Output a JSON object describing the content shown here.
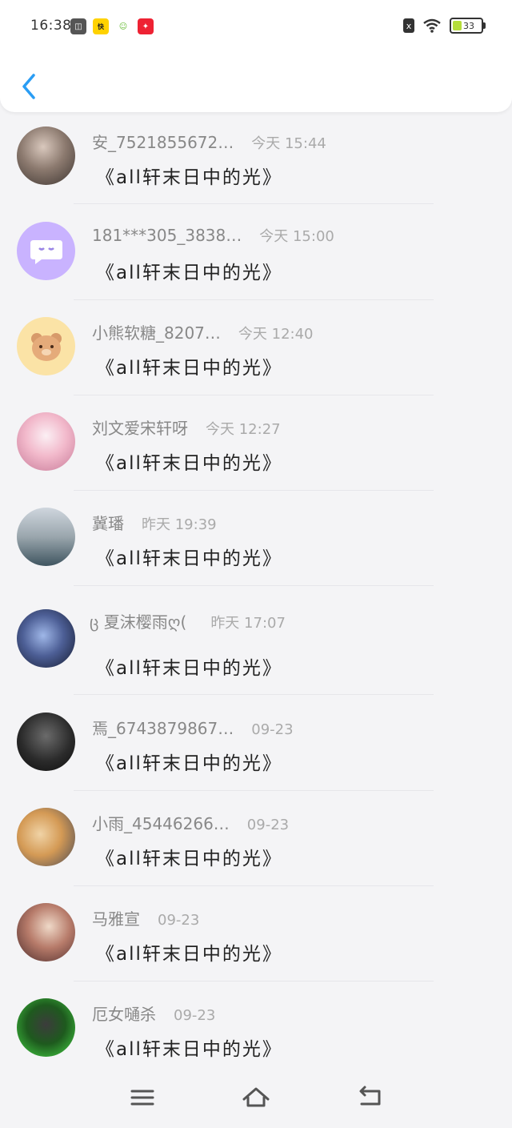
{
  "status_bar": {
    "time": "16:38",
    "notif_icons": [
      "app-icon",
      "app-icon-kuaidi",
      "app-icon-face",
      "app-icon-red"
    ],
    "battery_pct": "33",
    "sim_label": "x"
  },
  "header": {
    "back_icon": "chevron-left-icon"
  },
  "comments": [
    {
      "user": "安_7521855672…",
      "time": "今天 15:44",
      "text": "《all轩末日中的光》"
    },
    {
      "user": "181***305_3838…",
      "time": "今天 15:00",
      "text": "《all轩末日中的光》"
    },
    {
      "user": "小熊软糖_8207…",
      "time": "今天 12:40",
      "text": "《all轩末日中的光》"
    },
    {
      "user": "刘文爱宋轩呀",
      "time": "今天 12:27",
      "text": "《all轩末日中的光》"
    },
    {
      "user": "冀璠",
      "time": "昨天 19:39",
      "text": "《all轩末日中的光》"
    },
    {
      "user": "ც 夏沫樱雨ღ(",
      "time": "昨天 17:07",
      "text": "《all轩末日中的光》"
    },
    {
      "user": "焉_6743879867…",
      "time": "09-23",
      "text": "《all轩末日中的光》"
    },
    {
      "user": "小雨_45446266…",
      "time": "09-23",
      "text": "《all轩末日中的光》"
    },
    {
      "user": "马雅宣",
      "time": "09-23",
      "text": "《all轩末日中的光》"
    },
    {
      "user": "厄女嗵杀",
      "time": "09-23",
      "text": "《all轩末日中的光》"
    }
  ],
  "nav": {
    "menu_icon": "menu-icon",
    "home_icon": "home-icon",
    "back_icon": "back-icon"
  },
  "colors": {
    "accent": "#2a9df4",
    "avatar_bg": "#c9b3ff"
  }
}
